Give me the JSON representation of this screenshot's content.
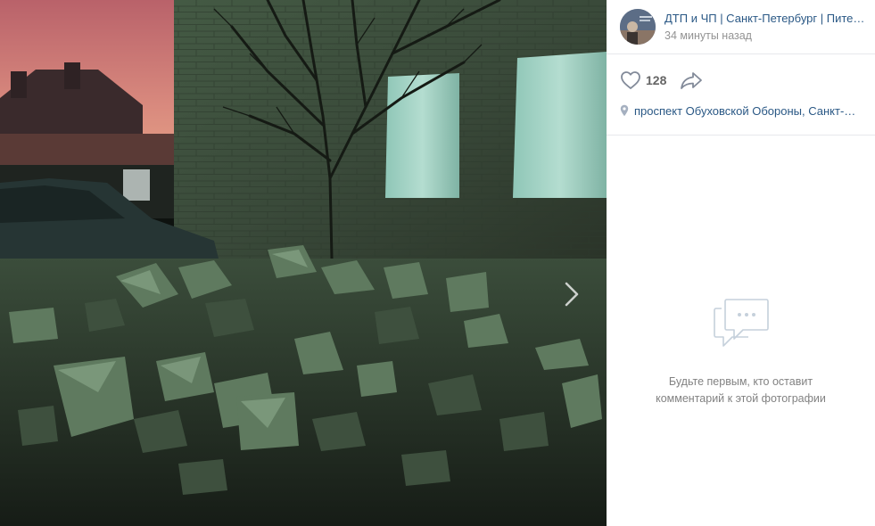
{
  "author": {
    "name": "ДТП и ЧП | Санкт-Петербург | Питер Онлайн | СПб",
    "time": "34 минуты назад"
  },
  "actions": {
    "likes": "128",
    "like_icon": "heart-icon",
    "share_icon": "share-arrow-icon"
  },
  "location": {
    "text": "проспект Обуховской Обороны, Санкт-Петербург",
    "icon": "map-pin-icon"
  },
  "comments": {
    "empty_line1": "Будьте первым, кто оставит",
    "empty_line2": "комментарий к этой фотографии",
    "icon": "comment-bubble-icon"
  },
  "photo": {
    "next_icon": "chevron-right-icon"
  },
  "colors": {
    "link": "#2a5885",
    "muted": "#939393",
    "icon": "#828a99"
  }
}
